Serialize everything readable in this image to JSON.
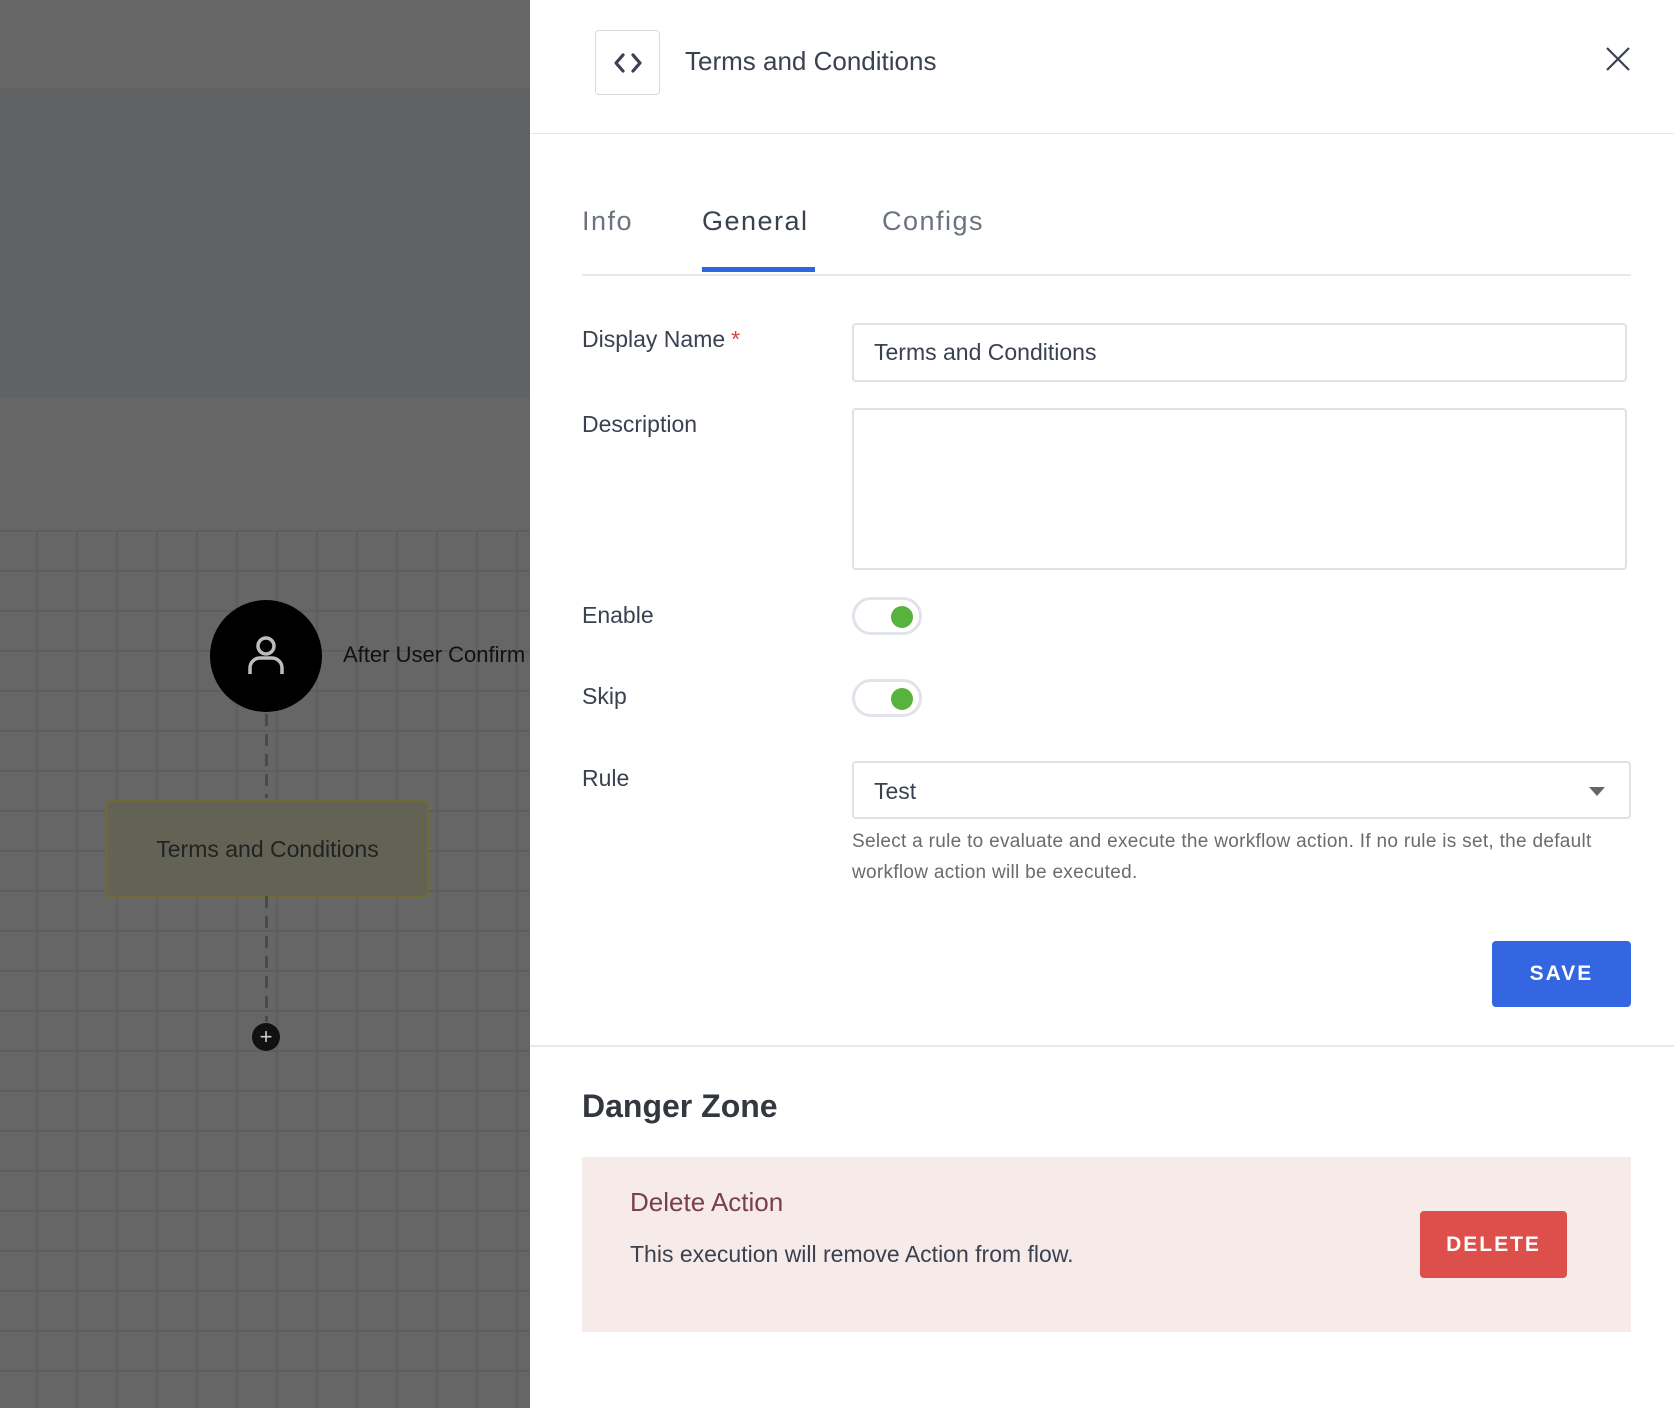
{
  "canvas": {
    "trigger_label": "After User Confirm",
    "action_node_label": "Terms and Conditions",
    "add_step_icon": "plus-icon",
    "trigger_icon": "user-icon"
  },
  "panel": {
    "header": {
      "icon": "code-icon",
      "title": "Terms and Conditions",
      "close_icon": "close-icon"
    },
    "tabs": [
      {
        "label": "Info",
        "active": false
      },
      {
        "label": "General",
        "active": true
      },
      {
        "label": "Configs",
        "active": false
      }
    ],
    "form": {
      "display_name_label": "Display Name",
      "required_marker": "*",
      "display_name_value": "Terms and Conditions",
      "description_label": "Description",
      "description_value": "",
      "enable_label": "Enable",
      "enable_value": true,
      "skip_label": "Skip",
      "skip_value": true,
      "rule_label": "Rule",
      "rule_value": "Test",
      "rule_help": "Select a rule to evaluate and execute the workflow action. If no rule is set, the default workflow action will be executed.",
      "save_label": "SAVE"
    },
    "danger_zone": {
      "title": "Danger Zone",
      "subtitle": "Delete Action",
      "text": "This execution will remove Action from flow.",
      "delete_label": "DELETE"
    }
  },
  "colors": {
    "accent": "#3366e0",
    "danger": "#dc4f4a",
    "toggle_on": "#57b33e",
    "danger_bg": "#f7ebe9"
  }
}
